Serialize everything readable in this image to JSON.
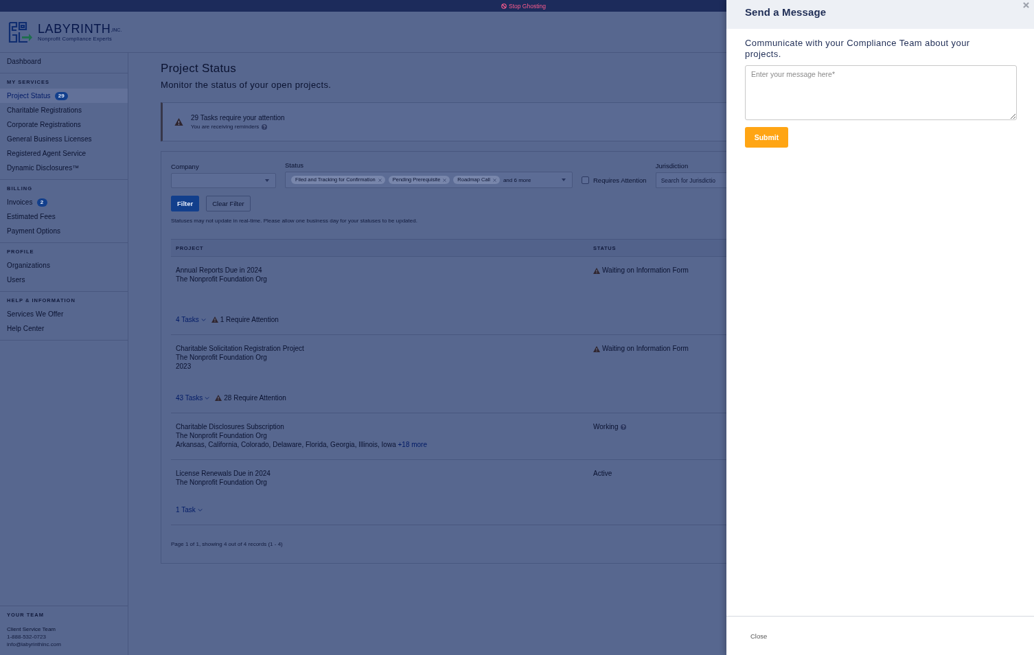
{
  "top_bar": {
    "link": "Stop Ghosting"
  },
  "logo": {
    "name": "LABYRINTH",
    "suffix": ",INC.",
    "tagline": "Nonprofit Compliance Experts"
  },
  "sidebar": {
    "sections": [
      {
        "items": [
          {
            "label": "Dashboard",
            "selected": false
          }
        ]
      },
      {
        "title": "MY SERVICES",
        "items": [
          {
            "label": "Project Status",
            "badge": "29",
            "selected": true
          },
          {
            "label": "Charitable Registrations",
            "selected": false
          },
          {
            "label": "Corporate Registrations",
            "selected": false
          },
          {
            "label": "General Business Licenses",
            "selected": false
          },
          {
            "label": "Registered Agent Service",
            "selected": false
          },
          {
            "label": "Dynamic Disclosures™",
            "selected": false
          }
        ]
      },
      {
        "title": "BILLING",
        "items": [
          {
            "label": "Invoices",
            "badge": "2",
            "selected": false
          },
          {
            "label": "Estimated Fees",
            "selected": false
          },
          {
            "label": "Payment Options",
            "selected": false
          }
        ]
      },
      {
        "title": "PROFILE",
        "items": [
          {
            "label": "Organizations",
            "selected": false
          },
          {
            "label": "Users",
            "selected": false
          }
        ]
      },
      {
        "title": "HELP & INFORMATION",
        "items": [
          {
            "label": "Services We Offer",
            "selected": false
          },
          {
            "label": "Help Center",
            "selected": false
          }
        ]
      }
    ],
    "team": {
      "title": "YOUR TEAM",
      "name": "Client Service Team",
      "phone": "1-888-532-0723",
      "email": "info@labyrinthinc.com"
    }
  },
  "page": {
    "title": "Project Status",
    "subtitle": "Monitor the status of your open projects."
  },
  "alert": {
    "title": "29 Tasks require your attention",
    "subtitle": "You are receiving reminders"
  },
  "filters": {
    "company": {
      "label": "Company"
    },
    "status": {
      "label": "Status",
      "chips": [
        "Filed and Tracking for Confirmation",
        "Pending Prerequisite",
        "Roadmap Call"
      ],
      "more": "and 6 more"
    },
    "requires_attention": {
      "label": "Requires Attention",
      "checked": false
    },
    "jurisdiction": {
      "label": "Jurisdiction",
      "placeholder": "Search for Jurisdictio"
    },
    "buttons": [
      {
        "label": "Filter",
        "kind": "primary"
      },
      {
        "label": "Clear Filter",
        "kind": "secondary"
      }
    ],
    "note": "Statuses may not update in real-time. Please allow one business day for your statuses to be updated."
  },
  "table": {
    "columns": [
      "PROJECT",
      "STATUS"
    ],
    "rows": [
      {
        "title": "Annual Reports Due in 2024",
        "organization": "The Nonprofit Foundation Org",
        "status": {
          "kind": "warning",
          "text": "Waiting on Information Form"
        },
        "tasks": "4 Tasks",
        "attention": "1 Require Attention"
      },
      {
        "title": "Charitable Solicitation Registration Project",
        "organization": "The Nonprofit Foundation Org",
        "details": "2023",
        "status": {
          "kind": "warning",
          "text": "Waiting on Information Form"
        },
        "tasks": "43 Tasks",
        "attention": "28 Require Attention"
      },
      {
        "title": "Charitable Disclosures Subscription",
        "organization": "The Nonprofit Foundation Org",
        "details": "Arkansas, California, Colorado, Delaware, Florida, Georgia, Illinois, Iowa",
        "more": "+18 more",
        "status": {
          "kind": "info",
          "text": "Working"
        }
      },
      {
        "title": "License Renewals Due in 2024",
        "organization": "The Nonprofit Foundation Org",
        "status": {
          "kind": "plain",
          "text": "Active"
        },
        "tasks": "1 Task"
      }
    ]
  },
  "pagination": "Page 1 of 1, showing 4 out of 4 records (1 - 4)",
  "drawer": {
    "title": "Send a Message",
    "description": "Communicate with your Compliance Team about your projects.",
    "message": {
      "placeholder": "Enter your message here*"
    },
    "submit": "Submit",
    "close": "Close"
  }
}
